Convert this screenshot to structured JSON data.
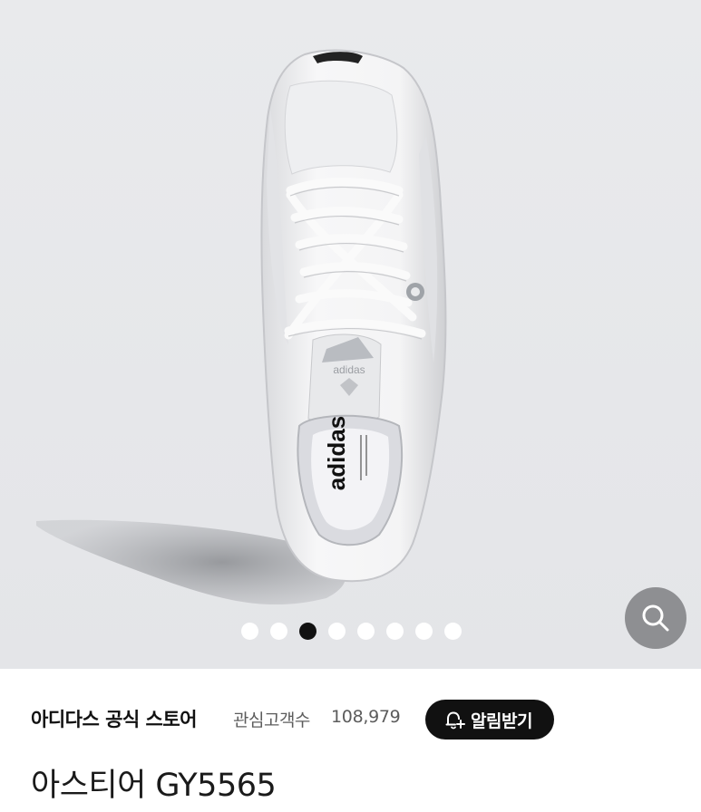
{
  "gallery": {
    "image_alt": "adidas",
    "dot_count": 8,
    "active_index": 2,
    "colors": {
      "background": "#e8e9eb",
      "dot_active": "#111111",
      "dot_inactive": "#ffffff",
      "zoom_bg": "#8e8f92"
    }
  },
  "zoom": {
    "icon": "search-icon"
  },
  "store": {
    "name": "아디다스 공식 스토어",
    "follower_label": "관심고객수",
    "follower_count": "108,979",
    "notify_label": "알림받기",
    "notify_icon": "bell-plus-icon"
  },
  "product": {
    "title": "아스티어 GY5565"
  }
}
